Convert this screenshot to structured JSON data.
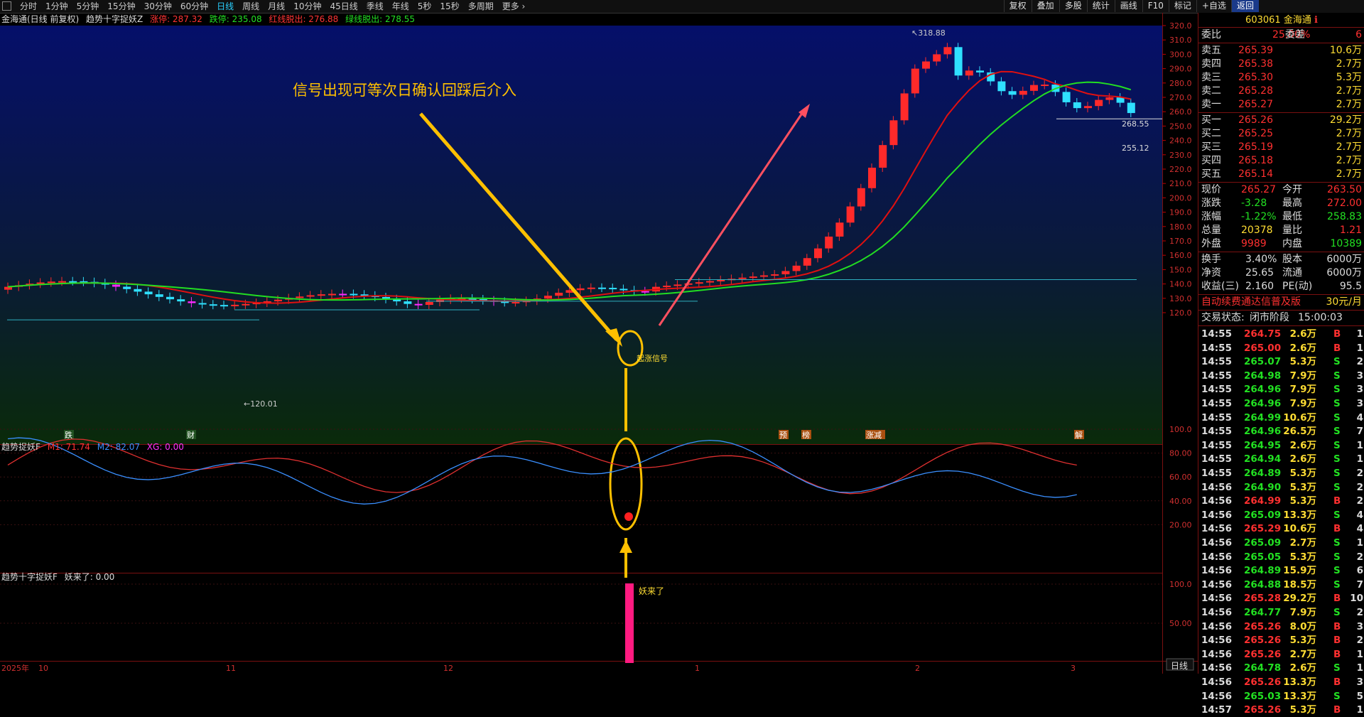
{
  "toolbar": {
    "periods": [
      "分时",
      "1分钟",
      "5分钟",
      "15分钟",
      "30分钟",
      "60分钟",
      "日线",
      "周线",
      "月线",
      "10分钟",
      "45日线",
      "季线",
      "年线",
      "5秒",
      "15秒",
      "多周期",
      "更多 ›"
    ],
    "active_period": "日线",
    "right_buttons": [
      "复权",
      "叠加",
      "多股",
      "统计",
      "画线",
      "F10",
      "标记",
      "+自选",
      "返回"
    ]
  },
  "main_chart": {
    "title": "金海通(日线 前复权)",
    "indicator_name": "趋势十字捉妖Z",
    "limit_up_label": "涨停: 287.32",
    "limit_down_label": "跌停: 235.08",
    "red_line_label": "红线脱出: 276.88",
    "green_line_label": "绿线脱出: 278.55",
    "annotation": "信号出现可等次日确认回踩后介入",
    "signal_label": "起涨信号",
    "price_labels": {
      "high": "318.88",
      "low": "120.01",
      "right_a": "268.55",
      "right_b": "255.12"
    },
    "y_axis": [
      "320.0",
      "310.0",
      "300.0",
      "290.0",
      "280.0",
      "270.0",
      "260.0",
      "250.0",
      "240.0",
      "230.0",
      "220.0",
      "210.0",
      "200.0",
      "190.0",
      "180.0",
      "170.0",
      "160.0",
      "150.0",
      "140.0",
      "130.0",
      "120.0"
    ],
    "event_tags": [
      "跌",
      "财",
      "预",
      "榜",
      "涨减",
      "解"
    ]
  },
  "sub1": {
    "name": "趋势捉妖F",
    "m1": "M1: 71.74",
    "m2": "M2: 82.07",
    "xg": "XG: 0.00",
    "y_axis": [
      "100.0",
      "80.00",
      "60.00",
      "40.00",
      "20.00"
    ]
  },
  "sub2": {
    "name": "趋势十字捉妖F",
    "label": "妖来了: 0.00",
    "bar_text": "妖来了",
    "y_axis": [
      "100.0",
      "50.00"
    ]
  },
  "x_axis": [
    "2025年",
    "10",
    "11",
    "12",
    "1",
    "2",
    "3"
  ],
  "bottom_tab": "日线",
  "quote": {
    "code": "603061",
    "name": "金海通",
    "wb_label": "委比",
    "wb_value": "25.00%",
    "wc_label": "委差",
    "wc_value": "6",
    "asks": [
      {
        "label": "卖五",
        "price": "265.39",
        "vol": "10.6万"
      },
      {
        "label": "卖四",
        "price": "265.38",
        "vol": "2.7万"
      },
      {
        "label": "卖三",
        "price": "265.30",
        "vol": "5.3万"
      },
      {
        "label": "卖二",
        "price": "265.28",
        "vol": "2.7万"
      },
      {
        "label": "卖一",
        "price": "265.27",
        "vol": "2.7万"
      }
    ],
    "bids": [
      {
        "label": "买一",
        "price": "265.26",
        "vol": "29.2万"
      },
      {
        "label": "买二",
        "price": "265.25",
        "vol": "2.7万"
      },
      {
        "label": "买三",
        "price": "265.19",
        "vol": "2.7万"
      },
      {
        "label": "买四",
        "price": "265.18",
        "vol": "2.7万"
      },
      {
        "label": "买五",
        "price": "265.14",
        "vol": "2.7万"
      }
    ],
    "stats": [
      {
        "l1": "现价",
        "v1": "265.27",
        "c1": "red",
        "l2": "今开",
        "v2": "263.50",
        "c2": "red"
      },
      {
        "l1": "涨跌",
        "v1": "-3.28",
        "c1": "green",
        "l2": "最高",
        "v2": "272.00",
        "c2": "red"
      },
      {
        "l1": "涨幅",
        "v1": "-1.22%",
        "c1": "green",
        "l2": "最低",
        "v2": "258.83",
        "c2": "green"
      },
      {
        "l1": "总量",
        "v1": "20378",
        "c1": "yellow",
        "l2": "量比",
        "v2": "1.21",
        "c2": "red"
      },
      {
        "l1": "外盘",
        "v1": "9989",
        "c1": "red",
        "l2": "内盘",
        "v2": "10389",
        "c2": "green"
      }
    ],
    "stats2": [
      {
        "l1": "换手",
        "v1": "3.40%",
        "l2": "股本",
        "v2": "6000万"
      },
      {
        "l1": "净资",
        "v1": "25.65",
        "l2": "流通",
        "v2": "6000万"
      },
      {
        "l1": "收益(三)",
        "v1": "2.160",
        "l2": "PE(动)",
        "v2": "95.5"
      }
    ],
    "promo": "自动续费通达信普及版",
    "promo_price": "30元/月",
    "status_label": "交易状态:",
    "status_value": "闭市阶段",
    "status_time": "15:00:03",
    "ticks": [
      [
        "14:55",
        "264.75",
        "2.6万",
        "B",
        "1"
      ],
      [
        "14:55",
        "265.00",
        "2.6万",
        "B",
        "1"
      ],
      [
        "14:55",
        "265.07",
        "5.3万",
        "S",
        "2"
      ],
      [
        "14:55",
        "264.98",
        "7.9万",
        "S",
        "3"
      ],
      [
        "14:55",
        "264.96",
        "7.9万",
        "S",
        "3"
      ],
      [
        "14:55",
        "264.96",
        "7.9万",
        "S",
        "3"
      ],
      [
        "14:55",
        "264.99",
        "10.6万",
        "S",
        "4"
      ],
      [
        "14:55",
        "264.96",
        "26.5万",
        "S",
        "7"
      ],
      [
        "14:55",
        "264.95",
        "2.6万",
        "S",
        "1"
      ],
      [
        "14:55",
        "264.94",
        "2.6万",
        "S",
        "1"
      ],
      [
        "14:55",
        "264.89",
        "5.3万",
        "S",
        "2"
      ],
      [
        "14:56",
        "264.90",
        "5.3万",
        "S",
        "2"
      ],
      [
        "14:56",
        "264.99",
        "5.3万",
        "B",
        "2"
      ],
      [
        "14:56",
        "265.09",
        "13.3万",
        "S",
        "4"
      ],
      [
        "14:56",
        "265.29",
        "10.6万",
        "B",
        "4"
      ],
      [
        "14:56",
        "265.09",
        "2.7万",
        "S",
        "1"
      ],
      [
        "14:56",
        "265.05",
        "5.3万",
        "S",
        "2"
      ],
      [
        "14:56",
        "264.89",
        "15.9万",
        "S",
        "6"
      ],
      [
        "14:56",
        "264.88",
        "18.5万",
        "S",
        "7"
      ],
      [
        "14:56",
        "265.28",
        "29.2万",
        "B",
        "10"
      ],
      [
        "14:56",
        "264.77",
        "7.9万",
        "S",
        "2"
      ],
      [
        "14:56",
        "265.26",
        "8.0万",
        "B",
        "3"
      ],
      [
        "14:56",
        "265.26",
        "5.3万",
        "B",
        "2"
      ],
      [
        "14:56",
        "265.26",
        "2.7万",
        "B",
        "1"
      ],
      [
        "14:56",
        "264.78",
        "2.6万",
        "S",
        "1"
      ],
      [
        "14:56",
        "265.26",
        "13.3万",
        "B",
        "3"
      ],
      [
        "14:56",
        "265.03",
        "13.3万",
        "S",
        "5"
      ],
      [
        "14:57",
        "265.26",
        "5.3万",
        "B",
        "1"
      ]
    ]
  },
  "colors": {
    "up": "#ff2a2a",
    "down": "#2fe0ff",
    "ma_red": "#e01010",
    "ma_green": "#22dd22",
    "accent": "#ffc000"
  }
}
